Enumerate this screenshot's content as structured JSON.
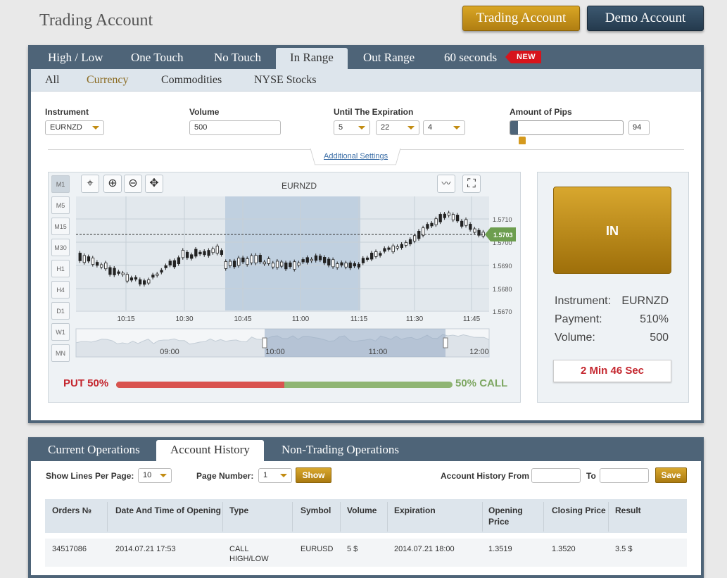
{
  "header": {
    "title": "Trading Account",
    "trading_btn": "Trading Account",
    "demo_btn": "Demo Account"
  },
  "option_tabs": [
    {
      "label": "High / Low"
    },
    {
      "label": "One Touch"
    },
    {
      "label": "No Touch"
    },
    {
      "label": "In Range",
      "active": true
    },
    {
      "label": "Out Range"
    },
    {
      "label": "60 seconds"
    }
  ],
  "new_badge": "NEW",
  "category_tabs": [
    {
      "label": "All"
    },
    {
      "label": "Currency",
      "selected": true
    },
    {
      "label": "Commodities"
    },
    {
      "label": "NYSE Stocks"
    }
  ],
  "form": {
    "instrument_label": "Instrument",
    "instrument_value": "EURNZD",
    "volume_label": "Volume",
    "volume_value": "500",
    "expiration_label": "Until The Expiration",
    "exp1": "5",
    "exp2": "22",
    "exp3": "4",
    "pips_label": "Amount of Pips",
    "pips_value": "94",
    "pips_level": 0.07,
    "additional_settings": "Additional Settings"
  },
  "chart": {
    "symbol": "EURNZD",
    "timeframes": [
      "M1",
      "M5",
      "M15",
      "M30",
      "H1",
      "H4",
      "D1",
      "W1",
      "MN"
    ],
    "active_timeframe": "M1",
    "price_ticks": [
      "1.5710",
      "1.5700",
      "1.5690",
      "1.5680",
      "1.5670"
    ],
    "current_price": "1.5703",
    "time_ticks": [
      "10:15",
      "10:30",
      "10:45",
      "11:00",
      "11:15",
      "11:30",
      "11:45"
    ],
    "nav_ticks": [
      "09:00",
      "10:00",
      "11:00",
      "12:00"
    ],
    "put_label": "PUT 50%",
    "call_label": "50% CALL",
    "put_share": 0.5
  },
  "trade": {
    "in_label": "IN",
    "instrument_label": "Instrument:",
    "instrument_value": "EURNZD",
    "payment_label": "Payment:",
    "payment_value": "510%",
    "volume_label": "Volume:",
    "volume_value": "500",
    "timer": "2 Min 46 Sec"
  },
  "history_tabs": [
    {
      "label": "Current Operations"
    },
    {
      "label": "Account History",
      "active": true
    },
    {
      "label": "Non-Trading Operations"
    }
  ],
  "history_controls": {
    "lines_label": "Show Lines Per Page:",
    "lines_value": "10",
    "page_label": "Page Number:",
    "page_value": "1",
    "show_btn": "Show",
    "from_label": "Account History  From",
    "to_label": "To",
    "save_btn": "Save"
  },
  "table": {
    "headers": [
      "Orders №",
      "Date And Time of Opening",
      "Type",
      "Symbol",
      "Volume",
      "Expiration",
      "Opening Price",
      "Closing Price",
      "Result"
    ],
    "rows": [
      [
        "34517086",
        "2014.07.21 17:53",
        "CALL HIGH/LOW",
        "EURUSD",
        "5 $",
        "2014.07.21 18:00",
        "1.3519",
        "1.3520",
        "3.5 $"
      ]
    ]
  },
  "colors": {
    "panel_border": "#4e6478",
    "gold": "#c28c12",
    "put": "#d9534f",
    "call": "#8fb573"
  }
}
